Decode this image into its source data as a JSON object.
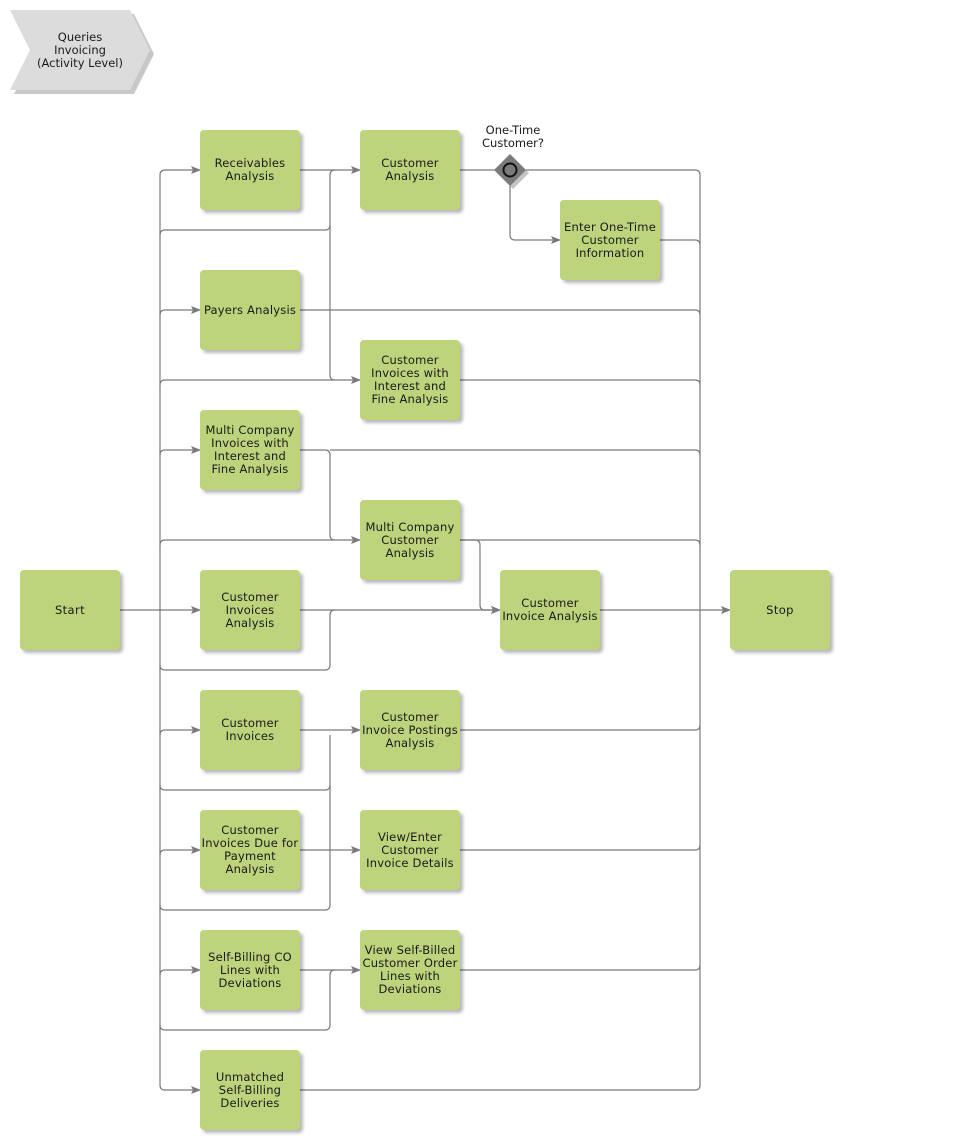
{
  "diagram": {
    "title": "Queries\nInvoicing\n(Activity Level)",
    "colors": {
      "task_fill": "#bdd37c",
      "edge": "#7a7a7a",
      "gateway_fill": "#7b7b7b",
      "title_fill": "#dcdcdc"
    },
    "gateway": {
      "id": "gw",
      "label": "One-Time\nCustomer?",
      "type": "exclusive-event"
    },
    "nodes": [
      {
        "id": "start",
        "label": "Start"
      },
      {
        "id": "receivables",
        "label": "Receivables\nAnalysis"
      },
      {
        "id": "payers",
        "label": "Payers Analysis"
      },
      {
        "id": "multico_interest",
        "label": "Multi Company\nInvoices with\nInterest and\nFine Analysis"
      },
      {
        "id": "cust_inv_analysis",
        "label": "Customer\nInvoices\nAnalysis"
      },
      {
        "id": "cust_invoices",
        "label": "Customer\nInvoices"
      },
      {
        "id": "due_payment",
        "label": "Customer\nInvoices Due for\nPayment\nAnalysis"
      },
      {
        "id": "selfbilling_co",
        "label": "Self-Billing CO\nLines with\nDeviations"
      },
      {
        "id": "unmatched",
        "label": "Unmatched\nSelf-Billing\nDeliveries"
      },
      {
        "id": "cust_analysis",
        "label": "Customer\nAnalysis"
      },
      {
        "id": "cust_interest",
        "label": "Customer\nInvoices with\nInterest and\nFine Analysis"
      },
      {
        "id": "multico_cust",
        "label": "Multi Company\nCustomer\nAnalysis"
      },
      {
        "id": "postings",
        "label": "Customer\nInvoice Postings\nAnalysis"
      },
      {
        "id": "view_details",
        "label": "View/Enter\nCustomer\nInvoice Details"
      },
      {
        "id": "view_selfbilled",
        "label": "View Self-Billed\nCustomer Order\nLines with\nDeviations"
      },
      {
        "id": "onetime",
        "label": "Enter One-Time\nCustomer\nInformation"
      },
      {
        "id": "cust_invoice_analysis",
        "label": "Customer\nInvoice Analysis"
      },
      {
        "id": "stop",
        "label": "Stop"
      }
    ],
    "edges": [
      [
        "start",
        "receivables"
      ],
      [
        "start",
        "payers"
      ],
      [
        "start",
        "multico_interest"
      ],
      [
        "start",
        "cust_inv_analysis"
      ],
      [
        "start",
        "cust_invoices"
      ],
      [
        "start",
        "due_payment"
      ],
      [
        "start",
        "selfbilling_co"
      ],
      [
        "start",
        "unmatched"
      ],
      [
        "start",
        "cust_analysis"
      ],
      [
        "start",
        "cust_interest"
      ],
      [
        "start",
        "multico_cust"
      ],
      [
        "start",
        "postings"
      ],
      [
        "start",
        "view_details"
      ],
      [
        "start",
        "view_selfbilled"
      ],
      [
        "start",
        "cust_invoice_analysis"
      ],
      [
        "receivables",
        "cust_analysis"
      ],
      [
        "payers",
        "cust_interest"
      ],
      [
        "multico_interest",
        "multico_cust"
      ],
      [
        "cust_inv_analysis",
        "cust_invoice_analysis"
      ],
      [
        "cust_invoices",
        "postings"
      ],
      [
        "due_payment",
        "view_details"
      ],
      [
        "selfbilling_co",
        "view_selfbilled"
      ],
      [
        "multico_cust",
        "cust_invoice_analysis"
      ],
      [
        "cust_analysis",
        "gw"
      ],
      [
        "gw",
        "onetime"
      ],
      [
        "gw",
        "stop"
      ],
      [
        "onetime",
        "stop"
      ],
      [
        "payers",
        "stop"
      ],
      [
        "cust_interest",
        "stop"
      ],
      [
        "multico_interest",
        "stop"
      ],
      [
        "multico_cust",
        "stop"
      ],
      [
        "cust_invoice_analysis",
        "stop"
      ],
      [
        "postings",
        "stop"
      ],
      [
        "view_details",
        "stop"
      ],
      [
        "view_selfbilled",
        "stop"
      ],
      [
        "unmatched",
        "stop"
      ]
    ]
  }
}
